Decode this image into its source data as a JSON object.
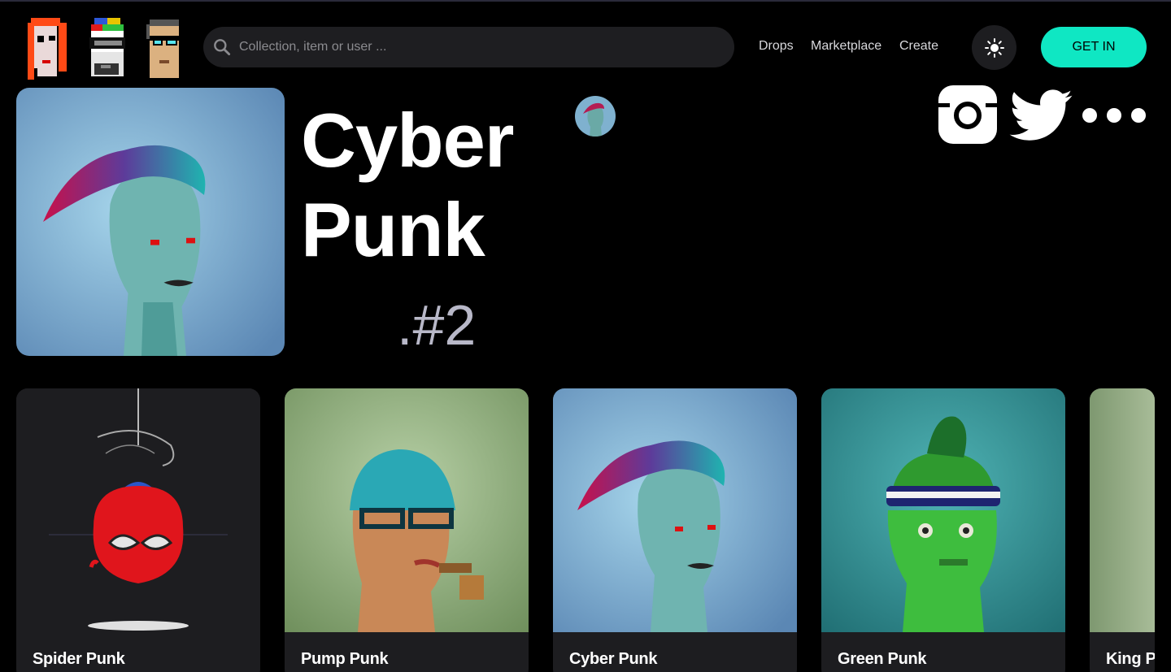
{
  "header": {
    "logo_alt": "CryptoPunks",
    "search_placeholder": "Collection, item or user ...",
    "nav": [
      "Drops",
      "Marketplace",
      "Create"
    ],
    "theme_toggle_icon": "sun-icon",
    "cta_label": "GET IN"
  },
  "hero": {
    "title_line1": "Cyber",
    "title_line2": "Punk",
    "token_id": ".#2",
    "social_icons": [
      "instagram-icon",
      "twitter-icon",
      "more-icon"
    ]
  },
  "cards": [
    {
      "name": "Spider Punk"
    },
    {
      "name": "Pump Punk"
    },
    {
      "name": "Cyber Punk"
    },
    {
      "name": "Green Punk"
    },
    {
      "name": "King Punk"
    }
  ],
  "colors": {
    "background": "#000000",
    "surface": "#1d1d20",
    "accent": "#0fe7c3",
    "muted_text": "#b8b8c8"
  }
}
